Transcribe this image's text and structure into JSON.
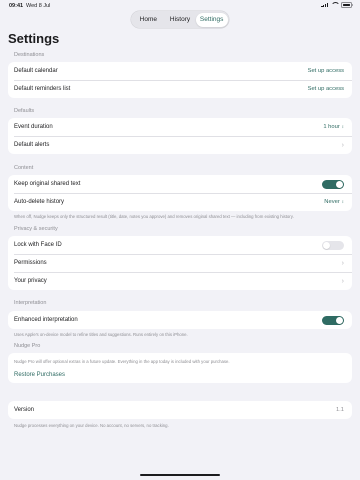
{
  "status_bar": {
    "time": "09:41",
    "date": "Wed 8 Jul"
  },
  "tabs": [
    {
      "label": "Home",
      "active": false
    },
    {
      "label": "History",
      "active": false
    },
    {
      "label": "Settings",
      "active": true
    }
  ],
  "title": "Settings",
  "colors": {
    "accent": "#2f6b63",
    "background": "#f2f2f7",
    "secondary_text": "#8e8e93"
  },
  "destinations": {
    "header": "Destinations",
    "default_calendar": {
      "label": "Default calendar",
      "value": "Set up access"
    },
    "default_reminders": {
      "label": "Default reminders list",
      "value": "Set up access"
    }
  },
  "defaults": {
    "header": "Defaults",
    "event_duration": {
      "label": "Event duration",
      "value": "1 hour"
    },
    "default_alerts": {
      "label": "Default alerts"
    }
  },
  "content": {
    "header": "Content",
    "keep_original": {
      "label": "Keep original shared text",
      "on": true
    },
    "auto_delete": {
      "label": "Auto-delete history",
      "value": "Never"
    },
    "footnote": "When off, Nudge keeps only the structured result (title, date, notes you approve) and removes original shared text — including from existing history."
  },
  "privacy": {
    "header": "Privacy & security",
    "face_id": {
      "label": "Lock with Face ID",
      "on": false
    },
    "permissions": {
      "label": "Permissions"
    },
    "your_privacy": {
      "label": "Your privacy"
    }
  },
  "interpretation": {
    "header": "Interpretation",
    "enhanced": {
      "label": "Enhanced interpretation",
      "on": true
    },
    "footnote": "Uses Apple's on-device model to refine titles and suggestions. Runs entirely on this iPhone."
  },
  "nudge_pro": {
    "header": "Nudge Pro",
    "description": "Nudge Pro will offer optional extras in a future update. Everything in the app today is included with your purchase.",
    "restore": "Restore Purchases"
  },
  "version": {
    "label": "Version",
    "value": "1.1"
  },
  "footer": "Nudge processes everything on your device. No account, no servers, no tracking."
}
